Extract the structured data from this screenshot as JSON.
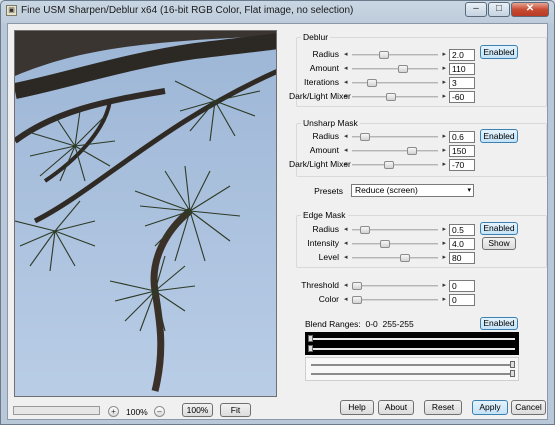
{
  "window": {
    "title": "Fine USM Sharpen/Deblur x64 (16-bit RGB Color, Flat image, no selection)",
    "controls": {
      "minimize": "–",
      "maximize": "□",
      "close": "✕"
    }
  },
  "preview": {
    "zoom": "100%",
    "zoom_out": "–",
    "zoom_in": "+",
    "btn_100": "100%",
    "btn_fit": "Fit"
  },
  "deblur": {
    "title": "Deblur",
    "rows": [
      {
        "label": "Radius",
        "value": "2.0",
        "level": 0.35
      },
      {
        "label": "Amount",
        "value": "110",
        "level": 0.6
      },
      {
        "label": "Iterations",
        "value": "3",
        "level": 0.2
      },
      {
        "label": "Dark/Light Mixer",
        "value": "-60",
        "level": 0.45
      }
    ],
    "enabled_label": "Enabled"
  },
  "unsharp": {
    "title": "Unsharp Mask",
    "rows": [
      {
        "label": "Radius",
        "value": "0.6",
        "level": 0.1
      },
      {
        "label": "Amount",
        "value": "150",
        "level": 0.72
      },
      {
        "label": "Dark/Light Mixer",
        "value": "-70",
        "level": 0.42
      }
    ],
    "enabled_label": "Enabled"
  },
  "presets": {
    "label": "Presets",
    "value": "Reduce (screen)"
  },
  "edge": {
    "title": "Edge Mask",
    "rows": [
      {
        "label": "Radius",
        "value": "0.5",
        "level": 0.1
      },
      {
        "label": "Intensity",
        "value": "4.0",
        "level": 0.37
      },
      {
        "label": "Level",
        "value": "80",
        "level": 0.63
      }
    ],
    "enabled_label": "Enabled",
    "show_label": "Show"
  },
  "threshold": {
    "label": "Threshold",
    "value": "0",
    "level": 0.0
  },
  "color": {
    "label": "Color",
    "value": "0",
    "level": 0.0
  },
  "blend": {
    "label": "Blend Ranges:",
    "low": "0-0",
    "high": "255-255",
    "enabled_label": "Enabled"
  },
  "buttons": {
    "help": "Help",
    "about": "About",
    "reset": "Reset",
    "apply": "Apply",
    "cancel": "Cancel"
  },
  "icons": {
    "app": "app-icon",
    "left_arrow": "◂",
    "right_arrow": "▸",
    "dropdown": "▾"
  }
}
